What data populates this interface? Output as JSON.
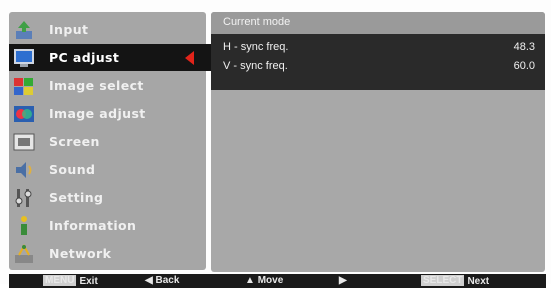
{
  "menu": {
    "items": [
      {
        "label": "Input",
        "icon": "input-icon"
      },
      {
        "label": "PC adjust",
        "icon": "pc-adjust-icon"
      },
      {
        "label": "Image select",
        "icon": "image-select-icon"
      },
      {
        "label": "Image adjust",
        "icon": "image-adjust-icon"
      },
      {
        "label": "Screen",
        "icon": "screen-icon"
      },
      {
        "label": "Sound",
        "icon": "sound-icon"
      },
      {
        "label": "Setting",
        "icon": "setting-icon"
      },
      {
        "label": "Information",
        "icon": "information-icon"
      },
      {
        "label": "Network",
        "icon": "network-icon"
      }
    ],
    "active_index": 1,
    "active_color": "#141414",
    "arrow_color": "#e2241a"
  },
  "panel": {
    "title": "Current mode",
    "rows": [
      {
        "key": "H - sync freq.",
        "value": "48.3"
      },
      {
        "key": "V - sync freq.",
        "value": "60.0"
      }
    ]
  },
  "help": {
    "exit_key": "MENU",
    "exit": "Exit",
    "back": "Back",
    "move": "Move",
    "next_key": "SELECT",
    "next": "Next"
  }
}
